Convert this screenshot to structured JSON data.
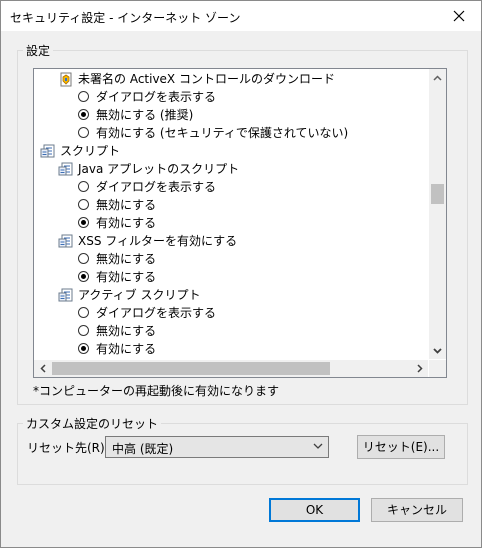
{
  "window": {
    "title": "セキュリティ設定 - インターネット ゾーン"
  },
  "settings_group": {
    "label": "設定",
    "items": [
      {
        "kind": "header",
        "indent": 1,
        "icon": "shield-app-icon",
        "label": "未署名の ActiveX コントロールのダウンロード"
      },
      {
        "kind": "radio",
        "indent": 2,
        "checked": false,
        "label": "ダイアログを表示する"
      },
      {
        "kind": "radio",
        "indent": 2,
        "checked": true,
        "label": "無効にする (推奨)"
      },
      {
        "kind": "radio",
        "indent": 2,
        "checked": false,
        "label": "有効にする (セキュリティで保護されていない)"
      },
      {
        "kind": "header",
        "indent": 0,
        "icon": "script-icon",
        "label": "スクリプト"
      },
      {
        "kind": "header",
        "indent": 1,
        "icon": "script-icon",
        "label": "Java アプレットのスクリプト"
      },
      {
        "kind": "radio",
        "indent": 2,
        "checked": false,
        "label": "ダイアログを表示する"
      },
      {
        "kind": "radio",
        "indent": 2,
        "checked": false,
        "label": "無効にする"
      },
      {
        "kind": "radio",
        "indent": 2,
        "checked": true,
        "label": "有効にする"
      },
      {
        "kind": "header",
        "indent": 1,
        "icon": "script-icon",
        "label": "XSS フィルターを有効にする"
      },
      {
        "kind": "radio",
        "indent": 2,
        "checked": false,
        "label": "無効にする"
      },
      {
        "kind": "radio",
        "indent": 2,
        "checked": true,
        "label": "有効にする"
      },
      {
        "kind": "header",
        "indent": 1,
        "icon": "script-icon",
        "label": "アクティブ スクリプト"
      },
      {
        "kind": "radio",
        "indent": 2,
        "checked": false,
        "label": "ダイアログを表示する"
      },
      {
        "kind": "radio",
        "indent": 2,
        "checked": false,
        "label": "無効にする"
      },
      {
        "kind": "radio",
        "indent": 2,
        "checked": true,
        "label": "有効にする"
      }
    ],
    "note": "*コンピューターの再起動後に有効になります"
  },
  "reset_group": {
    "label": "カスタム設定のリセット",
    "reset_to_label": "リセット先(R):",
    "reset_to_value": "中高 (既定)",
    "reset_button": "リセット(E)..."
  },
  "buttons": {
    "ok": "OK",
    "cancel": "キャンセル"
  },
  "colors": {
    "accent": "#0078d7",
    "window_bg": "#f0f0f0",
    "list_bg": "#ffffff"
  }
}
